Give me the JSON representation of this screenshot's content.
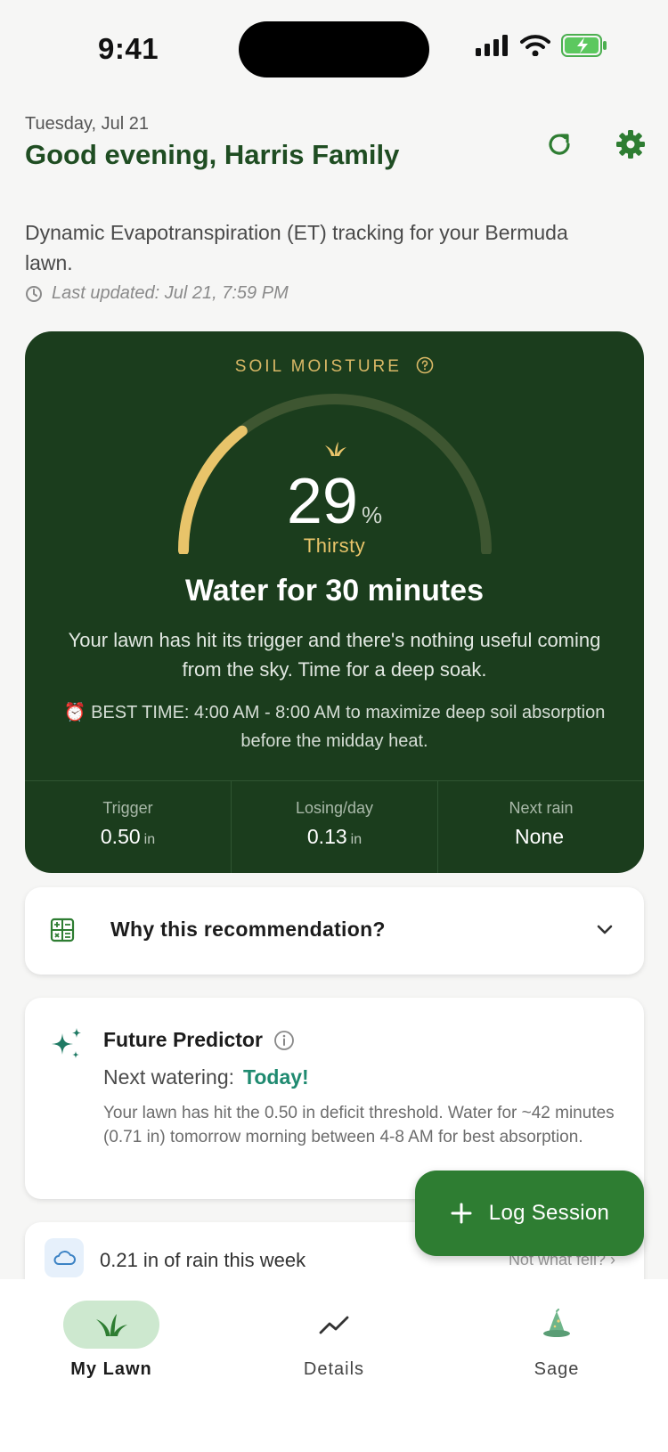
{
  "status_bar": {
    "time": "9:41"
  },
  "header": {
    "date": "Tuesday, Jul 21",
    "greeting": "Good evening, Harris Family",
    "subtitle": "Dynamic Evapotranspiration (ET) tracking for your Bermuda lawn.",
    "last_updated": "Last updated: Jul 21, 7:59 PM"
  },
  "moisture": {
    "label": "SOIL MOISTURE",
    "percent": "29",
    "percent_unit": "%",
    "gauge_fraction": 0.29,
    "state": "Thirsty",
    "headline": "Water for 30 minutes",
    "description": "Your lawn has hit its trigger and there's nothing useful coming from the sky. Time for a deep soak.",
    "best_time": "⏰ BEST TIME: 4:00 AM - 8:00 AM to maximize deep soil absorption before the midday heat.",
    "stats": [
      {
        "label": "Trigger",
        "value": "0.50",
        "unit": "in"
      },
      {
        "label": "Losing/day",
        "value": "0.13",
        "unit": "in"
      },
      {
        "label": "Next rain",
        "value": "None",
        "unit": ""
      }
    ]
  },
  "why": {
    "title": "Why this recommendation?"
  },
  "predictor": {
    "title": "Future Predictor",
    "next_label": "Next watering:",
    "next_value": "Today!",
    "body": "Your lawn has hit the 0.50 in deficit threshold. Water for ~42 minutes (0.71 in) tomorrow morning between 4-8 AM for best absorption."
  },
  "rain": {
    "text": "0.21 in of rain this week",
    "link": "Not what fell?  ›"
  },
  "fab": {
    "label": "Log Session"
  },
  "nav": [
    {
      "label": "My Lawn",
      "icon": "grass-icon",
      "active": true
    },
    {
      "label": "Details",
      "icon": "trend-icon",
      "active": false
    },
    {
      "label": "Sage",
      "icon": "wizard-hat-icon",
      "active": false
    }
  ],
  "colors": {
    "card_dark": "#1b3d1d",
    "accent_gold": "#e8c46a",
    "brand_green": "#2e7d32",
    "teal": "#1f8a70"
  }
}
